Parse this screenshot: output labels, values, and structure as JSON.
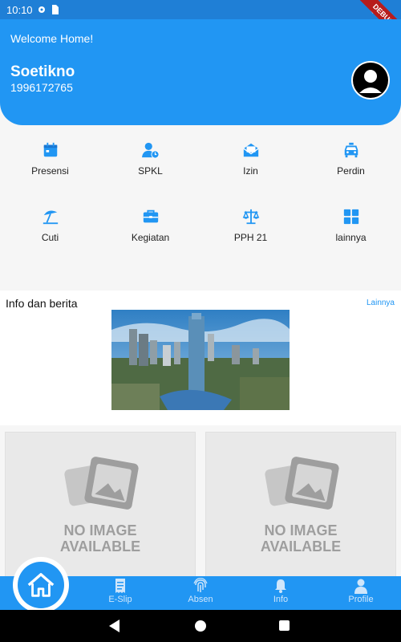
{
  "status_bar": {
    "time": "10:10",
    "debug_label": "DEBUG"
  },
  "header": {
    "welcome_text": "Welcome Home!",
    "user_name": "Soetikno",
    "user_id": "1996172765"
  },
  "menu": {
    "items": [
      {
        "label": "Presensi",
        "icon": "calendar-icon"
      },
      {
        "label": "SPKL",
        "icon": "user-clock-icon"
      },
      {
        "label": "Izin",
        "icon": "envelope-open-icon"
      },
      {
        "label": "Perdin",
        "icon": "taxi-icon"
      },
      {
        "label": "Cuti",
        "icon": "umbrella-beach-icon"
      },
      {
        "label": "Kegiatan",
        "icon": "briefcase-icon"
      },
      {
        "label": "PPH 21",
        "icon": "balance-scale-icon"
      },
      {
        "label": "lainnya",
        "icon": "grid-icon"
      }
    ]
  },
  "news": {
    "title": "Info dan berita",
    "more_link": "Lainnya"
  },
  "cards": [
    {
      "placeholder_line1": "NO IMAGE",
      "placeholder_line2": "AVAILABLE"
    },
    {
      "placeholder_line1": "NO IMAGE",
      "placeholder_line2": "AVAILABLE"
    }
  ],
  "bottom_nav": {
    "home_icon": "home-icon",
    "items": [
      {
        "label": "E-Slip",
        "icon": "receipt-icon"
      },
      {
        "label": "Absen",
        "icon": "fingerprint-icon"
      },
      {
        "label": "Info",
        "icon": "bell-icon"
      },
      {
        "label": "Profile",
        "icon": "user-icon"
      }
    ]
  },
  "colors": {
    "primary": "#2196f3",
    "status_bar": "#1f7fd6",
    "background": "#f6f6f6"
  }
}
